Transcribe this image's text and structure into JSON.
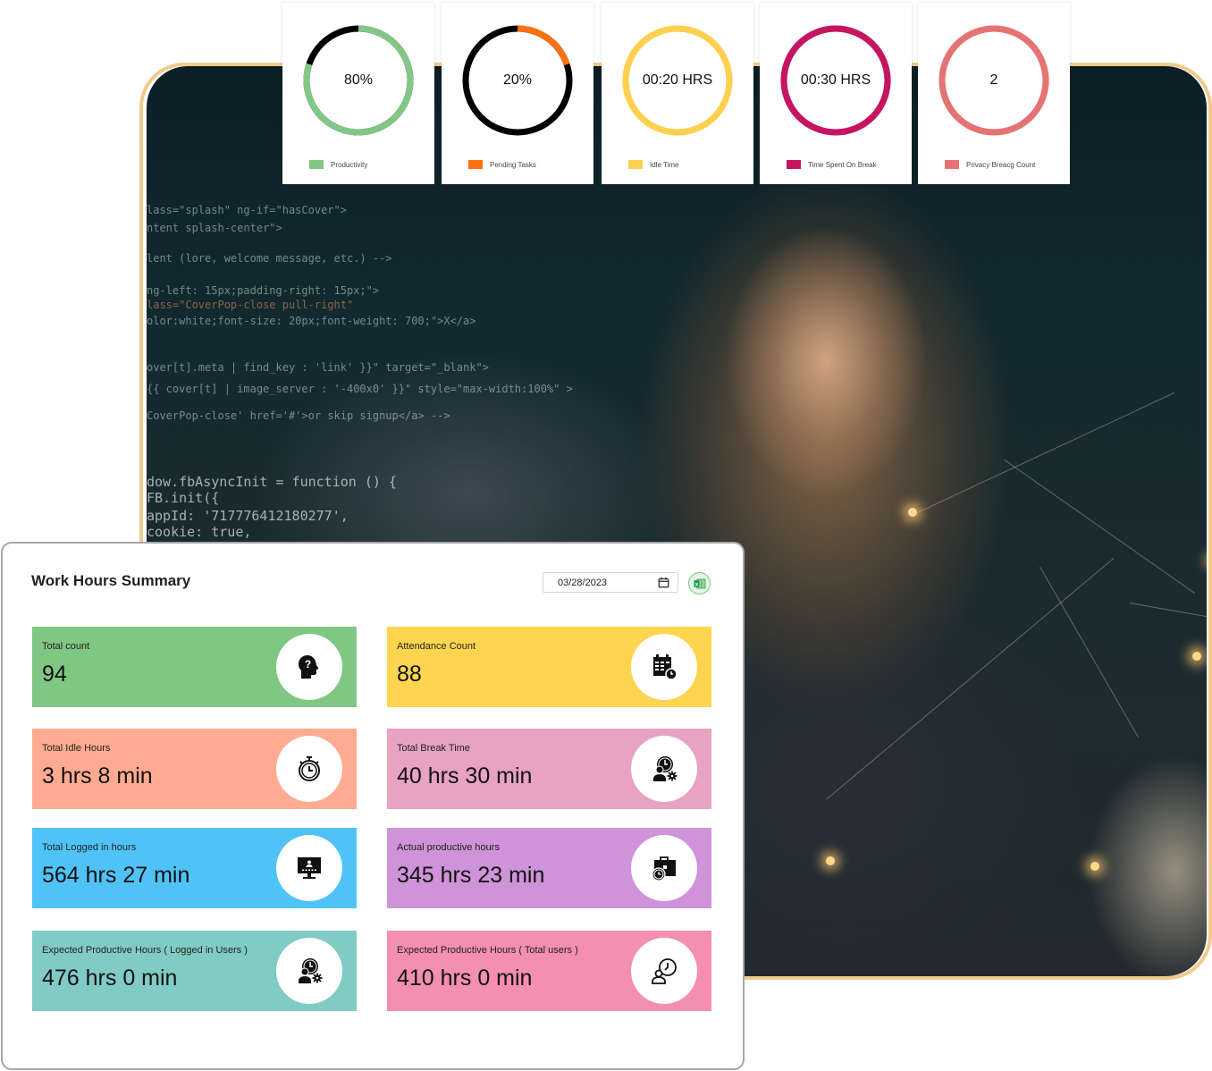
{
  "metrics": [
    {
      "label": "Productivity",
      "value_text": "80%",
      "progress_percent": 80,
      "color": "#82c785",
      "track_color": "#000000"
    },
    {
      "label": "Pending Tasks",
      "value_text": "20%",
      "progress_percent": 20,
      "color": "#fb700f",
      "track_color": "#000000"
    },
    {
      "label": "Idle Time",
      "value_text": "00:20 HRS",
      "progress_percent": 100,
      "color": "#fdd04f",
      "track_color": "#fdd04f"
    },
    {
      "label": "Time Spent On Break",
      "value_text": "00:30 HRS",
      "progress_percent": 100,
      "color": "#c61560",
      "track_color": "#c61560"
    },
    {
      "label": "Privacy Breacg Count",
      "value_text": "2",
      "progress_percent": 100,
      "color": "#e57373",
      "track_color": "#e57373"
    }
  ],
  "summary": {
    "title": "Work Hours Summary",
    "date_value": "03/28/2023",
    "export_icon": "excel-icon",
    "cards": [
      {
        "label": "Total count",
        "value": "94",
        "color": "#81c784",
        "icon": "head-question-icon"
      },
      {
        "label": "Attendance Count",
        "value": "88",
        "color": "#ffd54f",
        "icon": "calendar-clock-icon"
      },
      {
        "label": "Total Idle Hours",
        "value": "3 hrs 8 min",
        "color": "#ffab91",
        "icon": "stopwatch-icon"
      },
      {
        "label": "Total Break Time",
        "value": "40 hrs 30 min",
        "color": "#e8a2c2",
        "icon": "person-clock-gear-icon"
      },
      {
        "label": "Total Logged in hours",
        "value": "564 hrs 27 min",
        "color": "#4fc3f7",
        "icon": "monitor-login-icon"
      },
      {
        "label": "Actual productive hours",
        "value": "345 hrs 23 min",
        "color": "#ce93d8",
        "icon": "briefcase-clock-icon"
      },
      {
        "label": "Expected Productive Hours ( Logged in Users )",
        "value": "476 hrs 0 min",
        "color": "#80cbc4",
        "icon": "person-clock-gear-icon"
      },
      {
        "label": "Expected Productive Hours ( Total users )",
        "value": "410 hrs 0 min",
        "color": "#f48fb1",
        "icon": "person-clock-icon"
      }
    ]
  },
  "background": {
    "code_snippets": [
      "lass=\"splash\" ng-if=\"hasCover\">",
      "ntent splash-center\">",
      "lent (lore, welcome message, etc.) -->",
      "ng-left: 15px;padding-right: 15px;\">",
      "lass=\"CoverPop-close pull-right\"",
      "olor:white;font-size: 20px;font-weight: 700;\">X</a>",
      "over[t].meta | find_key : 'link' }}\" target=\"_blank\">",
      "{{ cover[t] | image_server : '-400x0' }}\" style=\"max-width:100%\" >",
      "CoverPop-close' href='#'>or skip signup</a> -->",
      "dow.fbAsyncInit = function () {",
      "  FB.init({",
      "    appId: '717776412180277',",
      "    cookie: true,"
    ]
  }
}
